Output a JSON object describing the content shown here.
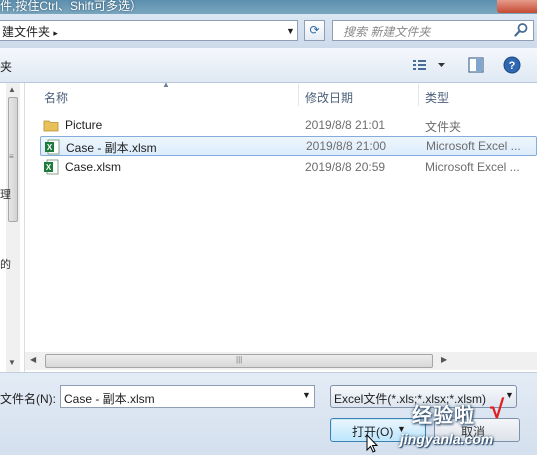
{
  "window": {
    "title_fragment": "件,按住Ctrl、Shift可多选）"
  },
  "address": {
    "path_label": "建文件夹",
    "separator": "▸"
  },
  "search": {
    "placeholder": "搜索 新建文件夹"
  },
  "toolbar": {
    "left_label": "夹"
  },
  "nav": {
    "fragment1": "理",
    "fragment2": "的"
  },
  "columns": {
    "name": "名称",
    "date": "修改日期",
    "type": "类型"
  },
  "files": [
    {
      "name": "Picture",
      "date": "2019/8/8 21:01",
      "type": "文件夹",
      "icon": "folder-icon",
      "selected": false
    },
    {
      "name": "Case - 副本.xlsm",
      "date": "2019/8/8 21:00",
      "type": "Microsoft Excel ...",
      "icon": "excel-file-icon",
      "selected": true
    },
    {
      "name": "Case.xlsm",
      "date": "2019/8/8 20:59",
      "type": "Microsoft Excel ...",
      "icon": "excel-file-icon",
      "selected": false
    }
  ],
  "footer": {
    "filename_label": "文件名(N):",
    "filename_value": "Case - 副本.xlsm",
    "filetype_value": "Excel文件(*.xls;*.xlsx;*.xlsm)",
    "open_label": "打开(O)",
    "cancel_label": "取消"
  },
  "watermark": {
    "line1": "经验啦",
    "check": "√",
    "line2": "jingyanla.com"
  },
  "colors": {
    "accent": "#3c7fb1",
    "selection": "#dcecfb",
    "excel_green": "#1d7a3c",
    "folder": "#e8c15a"
  }
}
